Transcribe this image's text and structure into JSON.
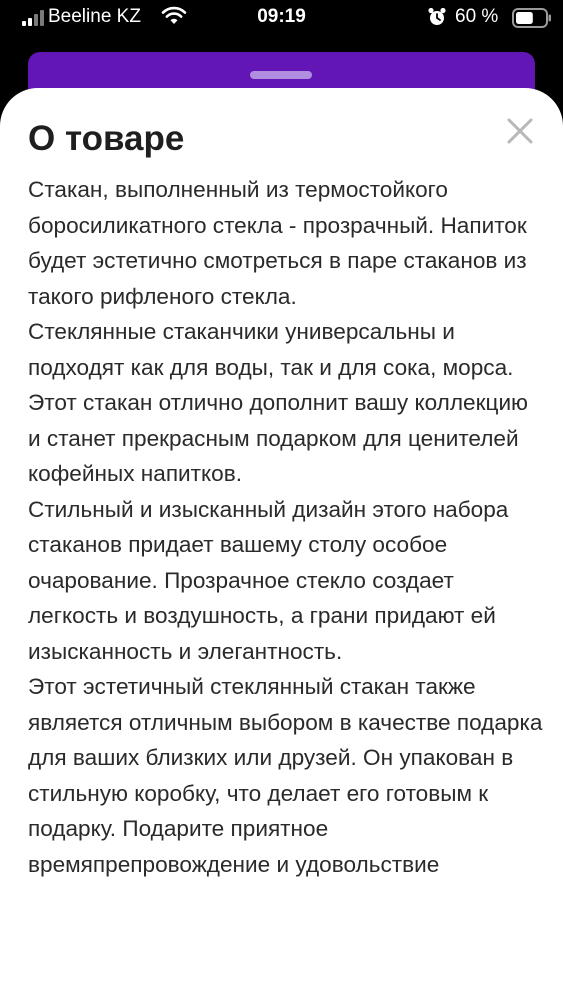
{
  "status_bar": {
    "carrier": "Beeline KZ",
    "time": "09:19",
    "battery_percent": "60 %",
    "icons": [
      "signal-icon",
      "wifi-icon",
      "alarm-icon",
      "battery-icon"
    ],
    "battery_level": 0.6
  },
  "modal": {
    "title": "О товаре",
    "close_icon": "close-icon",
    "paragraphs": [
      "Стакан, выполненный из термостойкого боросиликатного стекла - прозрачный. Напиток будет эстетично смотреться в паре стаканов из такого рифленого стекла.",
      "Стеклянные стаканчики универсальны и подходят как для воды, так и для сока, морса. Этот стакан отлично дополнит вашу коллекцию и станет прекрасным подарком для ценителей кофейных напитков.",
      "Стильный и изысканный дизайн этого набора стаканов придает вашему столу особое очарование. Прозрачное стекло создает легкость и воздушность, а грани придают ей изысканность и элегантность.",
      "Этот эстетичный стеклянный стакан также является отличным выбором в качестве подарка для ваших близких или друзей. Он упакован в стильную коробку, что делает его готовым к подарку.  Подарите приятное времяпрепровождение и удовольствие"
    ]
  },
  "colors": {
    "accent_purple": "#6316b6",
    "grabber": "#b28ee0",
    "text": "#2a2a2a",
    "close_icon": "#b8b8b8"
  }
}
